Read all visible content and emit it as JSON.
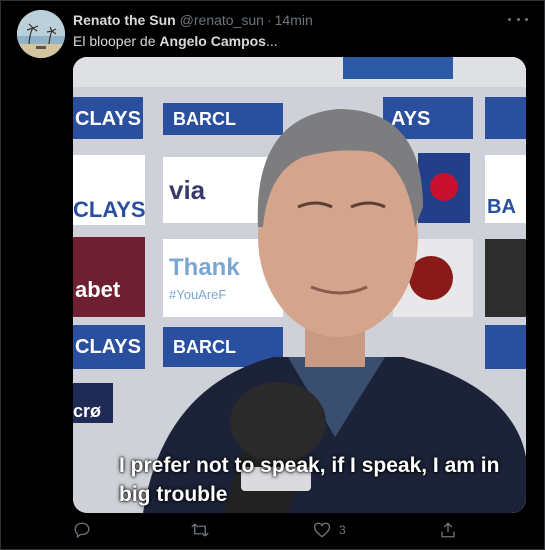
{
  "tweet": {
    "author_name": "Renato the Sun",
    "author_handle": "@renato_sun",
    "separator": "·",
    "time": "14min",
    "text_prefix": "El blooper de ",
    "text_bold": "Angelo Campos",
    "text_suffix": "..."
  },
  "media": {
    "caption": "I prefer not to speak, if I speak, I am in big trouble",
    "backdrop_texts": [
      "CLAYS",
      "BARCL",
      "AYS",
      "via",
      "BA",
      "Thank",
      "#YouAreF",
      "abet",
      "CLAYS",
      "BARCL",
      "crø"
    ]
  },
  "actions": {
    "reply_icon": "reply-icon",
    "retweet_icon": "retweet-icon",
    "like_icon": "heart-icon",
    "like_count": "3",
    "share_icon": "share-icon"
  },
  "colors": {
    "background": "#000000",
    "text": "#d9d9d9",
    "muted": "#6e767d",
    "border": "#2f3336"
  }
}
